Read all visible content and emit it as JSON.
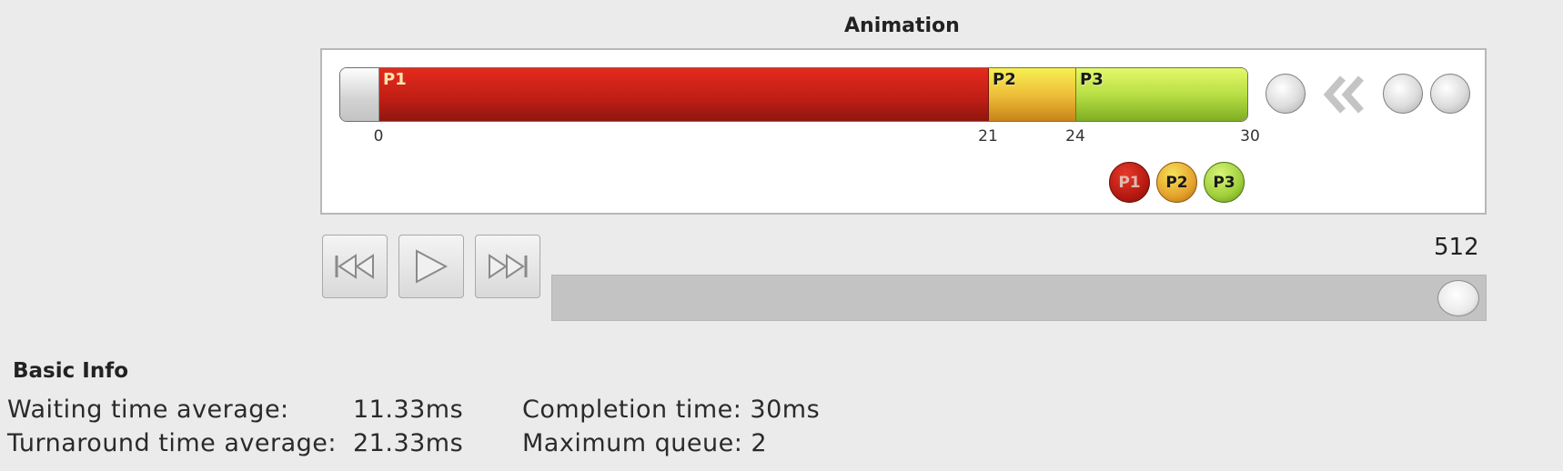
{
  "animation": {
    "title": "Animation",
    "gantt": [
      {
        "label": "",
        "start": 0,
        "end": 0
      },
      {
        "label": "P1",
        "start": 0,
        "end": 21
      },
      {
        "label": "P2",
        "start": 21,
        "end": 24
      },
      {
        "label": "P3",
        "start": 24,
        "end": 30
      }
    ],
    "ticks": [
      "0",
      "21",
      "24",
      "30"
    ],
    "queue_icon": "chevron-left-double-icon",
    "legend": [
      "P1",
      "P2",
      "P3"
    ],
    "colors": {
      "P1": "#c21f15",
      "P2": "#eebf3a",
      "P3": "#b8df45"
    }
  },
  "controls": {
    "rewind_icon": "rewind-icon",
    "play_icon": "play-icon",
    "forward_icon": "fast-forward-icon",
    "speed_value": "512",
    "speed_fraction": 1.0
  },
  "basic_info": {
    "title": "Basic Info",
    "waiting_label": "Waiting time average:",
    "waiting_value": "11.33ms",
    "turnaround_label": "Turnaround time average:",
    "turnaround_value": "21.33ms",
    "completion": "Completion time: 30ms",
    "max_queue": "Maximum queue: 2"
  }
}
